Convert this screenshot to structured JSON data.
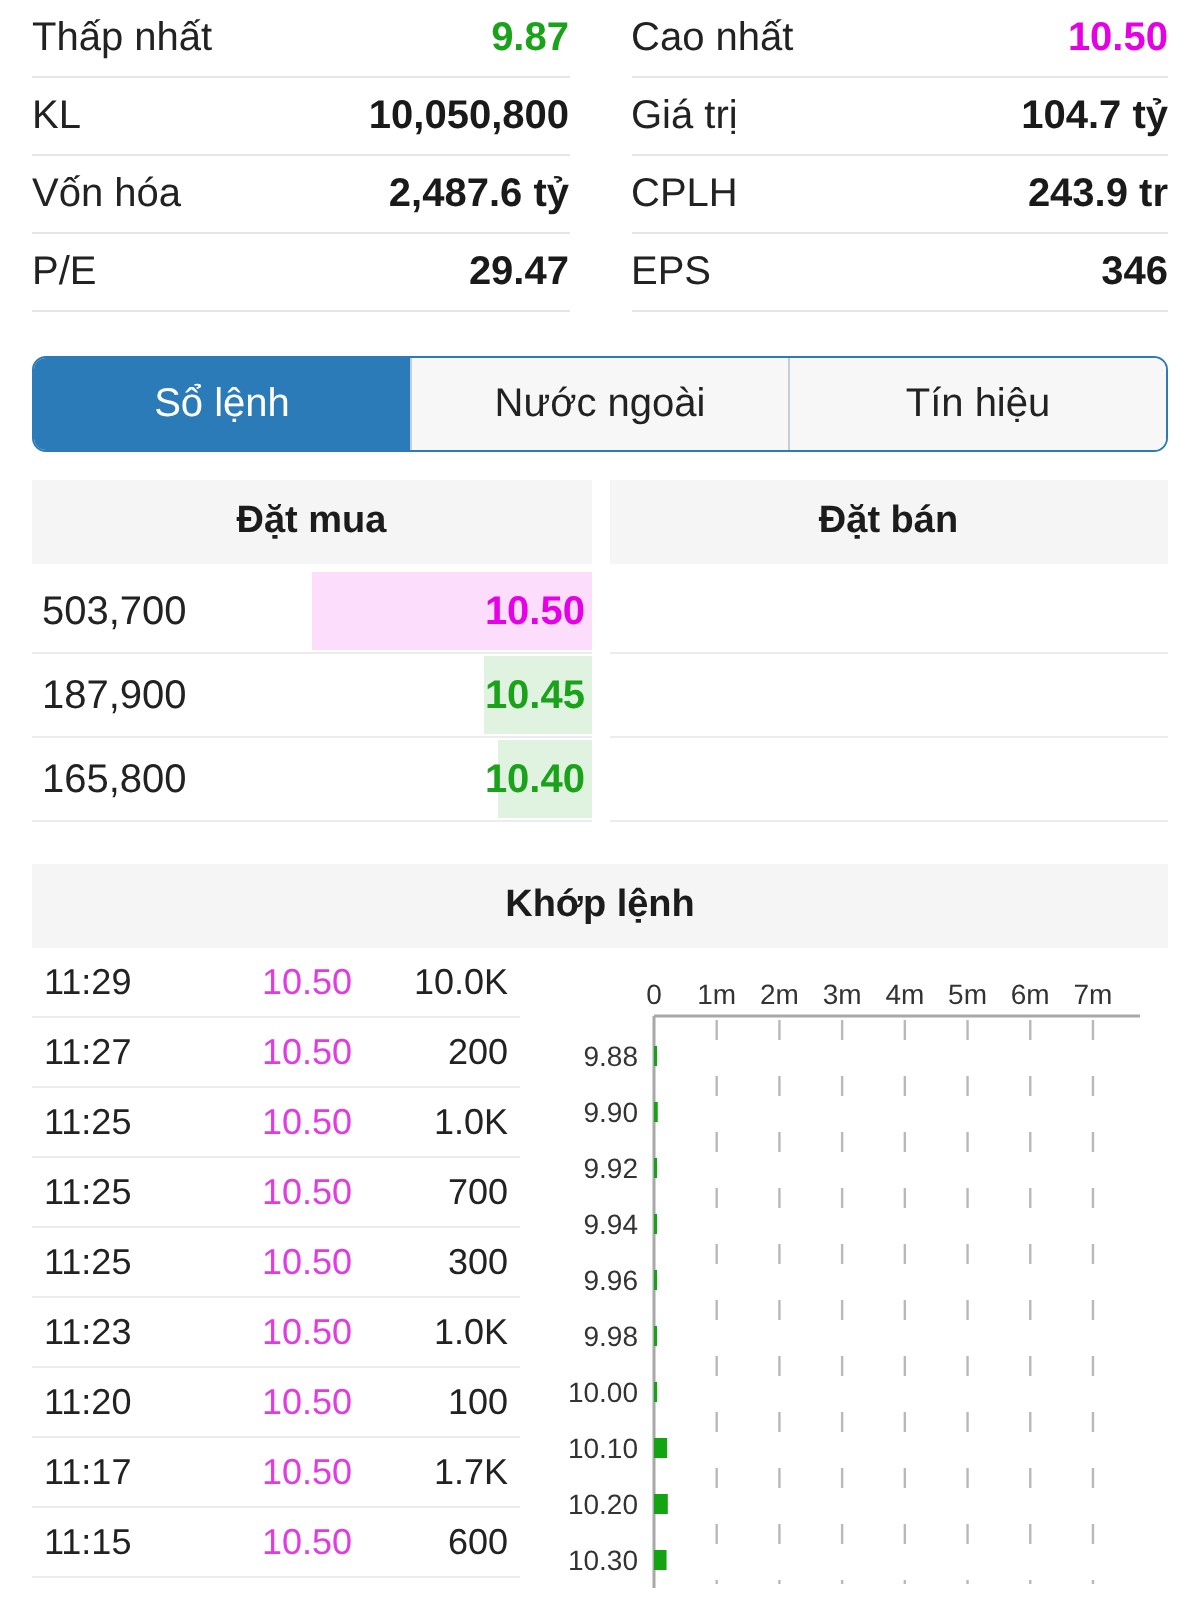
{
  "stats": [
    {
      "label": "Thấp nhất",
      "value": "9.87",
      "color": "#1aa31a"
    },
    {
      "label": "Cao nhất",
      "value": "10.50",
      "color": "#e600e6"
    },
    {
      "label": "KL",
      "value": "10,050,800"
    },
    {
      "label": "Giá trị",
      "value": "104.7 tỷ"
    },
    {
      "label": "Vốn hóa",
      "value": "2,487.6 tỷ"
    },
    {
      "label": "CPLH",
      "value": "243.9 tr"
    },
    {
      "label": "P/E",
      "value": "29.47"
    },
    {
      "label": "EPS",
      "value": "346"
    }
  ],
  "tabs": [
    {
      "label": "Sổ lệnh",
      "selected": true
    },
    {
      "label": "Nước ngoài",
      "selected": false
    },
    {
      "label": "Tín hiệu",
      "selected": false
    }
  ],
  "order_book": {
    "columns": [
      "Đặt mua",
      "Đặt bán"
    ],
    "bids": [
      {
        "volume": "503,700",
        "price": "10.50",
        "color": "#e600e6",
        "level": 0.5
      },
      {
        "volume": "187,900",
        "price": "10.45",
        "color": "#1aa31a",
        "level": 0.19
      },
      {
        "volume": "165,800",
        "price": "10.40",
        "color": "#1aa31a",
        "level": 0.165
      }
    ]
  },
  "matched_trades": {
    "title": "Khớp lệnh",
    "rows": [
      {
        "time": "11:29",
        "price": "10.50",
        "volume": "10.0K",
        "color": "#e23be3"
      },
      {
        "time": "11:27",
        "price": "10.50",
        "volume": "200",
        "color": "#e23be3"
      },
      {
        "time": "11:25",
        "price": "10.50",
        "volume": "1.0K",
        "color": "#e23be3"
      },
      {
        "time": "11:25",
        "price": "10.50",
        "volume": "700",
        "color": "#e23be3"
      },
      {
        "time": "11:25",
        "price": "10.50",
        "volume": "300",
        "color": "#e23be3"
      },
      {
        "time": "11:23",
        "price": "10.50",
        "volume": "1.0K",
        "color": "#e23be3"
      },
      {
        "time": "11:20",
        "price": "10.50",
        "volume": "100",
        "color": "#e23be3"
      },
      {
        "time": "11:17",
        "price": "10.50",
        "volume": "1.7K",
        "color": "#e23be3"
      },
      {
        "time": "11:15",
        "price": "10.50",
        "volume": "600",
        "color": "#e23be3"
      }
    ],
    "chart_data": {
      "type": "bar",
      "orientation": "horizontal",
      "grid": true,
      "categories": [
        "9.88",
        "9.90",
        "9.92",
        "9.94",
        "9.96",
        "9.98",
        "10.00",
        "10.10",
        "10.20",
        "10.30"
      ],
      "values": [
        20000,
        60000,
        40000,
        20000,
        40000,
        10000,
        50000,
        210000,
        220000,
        200000
      ],
      "xlim": [
        0,
        7750000
      ],
      "xticks": [
        {
          "value": 0,
          "label": "0"
        },
        {
          "value": 1000000,
          "label": "1m"
        },
        {
          "value": 2000000,
          "label": "2m"
        },
        {
          "value": 3000000,
          "label": "3m"
        },
        {
          "value": 4000000,
          "label": "4m"
        },
        {
          "value": 5000000,
          "label": "5m"
        },
        {
          "value": 6000000,
          "label": "6m"
        },
        {
          "value": 7000000,
          "label": "7m"
        }
      ]
    }
  }
}
